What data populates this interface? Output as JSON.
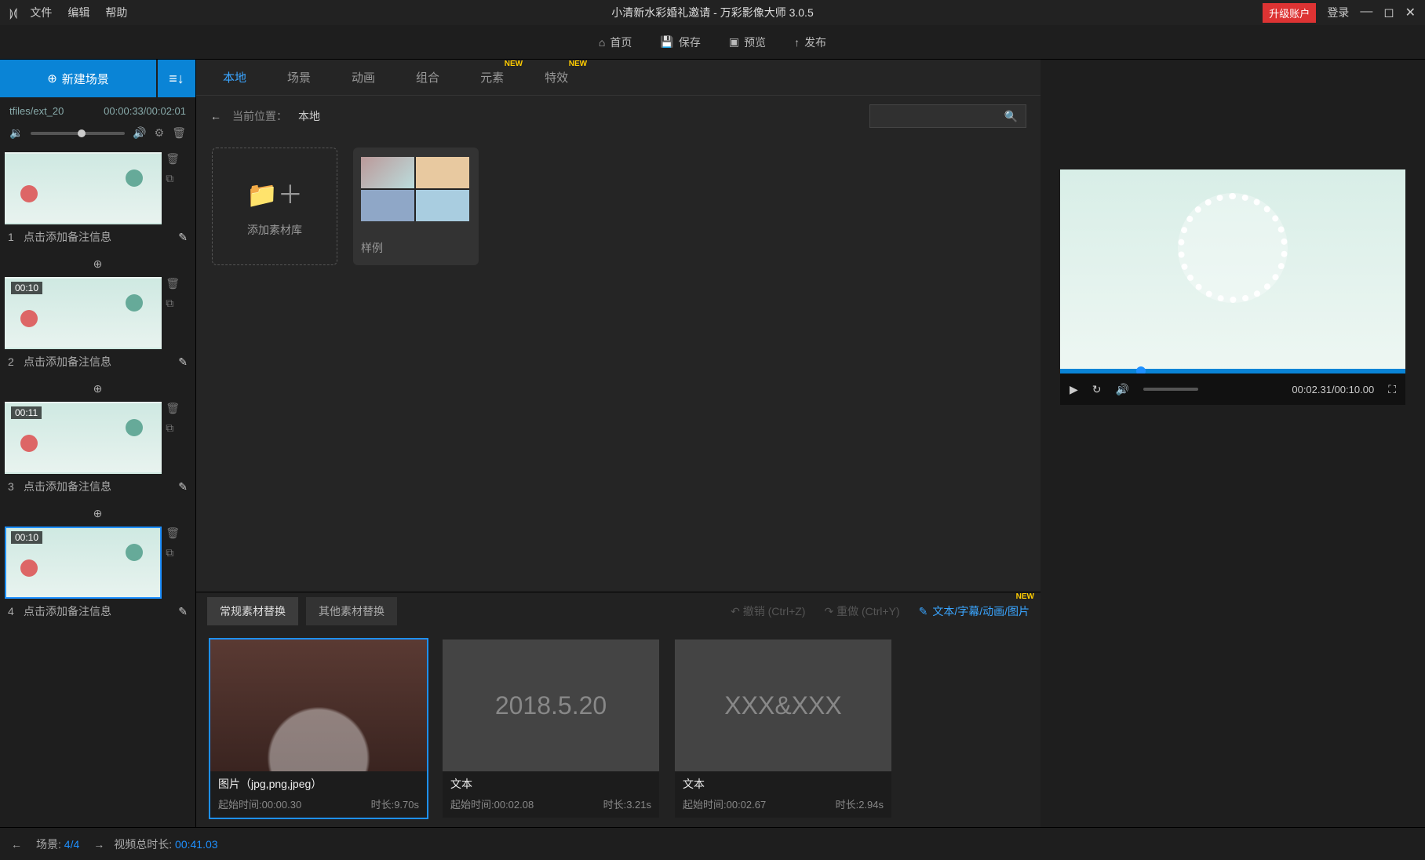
{
  "app": {
    "title": "小清新水彩婚礼邀请 - 万彩影像大师 3.0.5",
    "menu": {
      "file": "文件",
      "edit": "编辑",
      "help": "帮助"
    },
    "upgrade": "升级账户",
    "login": "登录"
  },
  "actions": {
    "home": "首页",
    "save": "保存",
    "preview": "预览",
    "publish": "发布"
  },
  "sidebar": {
    "new_scene": "新建场景",
    "file_path": "tfiles/ext_20",
    "time_info": "00:00:33/00:02:01",
    "scenes": [
      {
        "idx": "1",
        "time": "",
        "label": "点击添加备注信息"
      },
      {
        "idx": "2",
        "time": "00:10",
        "label": "点击添加备注信息"
      },
      {
        "idx": "3",
        "time": "00:11",
        "label": "点击添加备注信息"
      },
      {
        "idx": "4",
        "time": "00:10",
        "label": "点击添加备注信息"
      }
    ]
  },
  "tabs": {
    "local": "本地",
    "scene": "场景",
    "anim": "动画",
    "combo": "组合",
    "element": "元素",
    "effect": "特效",
    "new_tag": "NEW"
  },
  "breadcrumb": {
    "label": "当前位置：",
    "value": "本地"
  },
  "library": {
    "add": "添加素材库",
    "sample": "样例"
  },
  "bottom": {
    "tab_normal": "常规素材替换",
    "tab_other": "其他素材替换",
    "undo": "撤销 (Ctrl+Z)",
    "redo": "重做 (Ctrl+Y)",
    "link": "文本/字幕/动画/图片",
    "new_tag": "NEW",
    "items": [
      {
        "title": "图片（jpg,png,jpeg）",
        "start_lbl": "起始时间:00:00.30",
        "dur_lbl": "时长:9.70s",
        "preview": ""
      },
      {
        "title": "文本",
        "start_lbl": "起始时间:00:02.08",
        "dur_lbl": "时长:3.21s",
        "preview": "2018.5.20"
      },
      {
        "title": "文本",
        "start_lbl": "起始时间:00:02.67",
        "dur_lbl": "时长:2.94s",
        "preview": "XXX&XXX"
      }
    ]
  },
  "preview": {
    "time": "00:02.31/00:10.00"
  },
  "status": {
    "scene_lbl": "场景:",
    "scene_val": "4/4",
    "total_lbl": "视频总时长:",
    "total_val": "00:41.03"
  }
}
